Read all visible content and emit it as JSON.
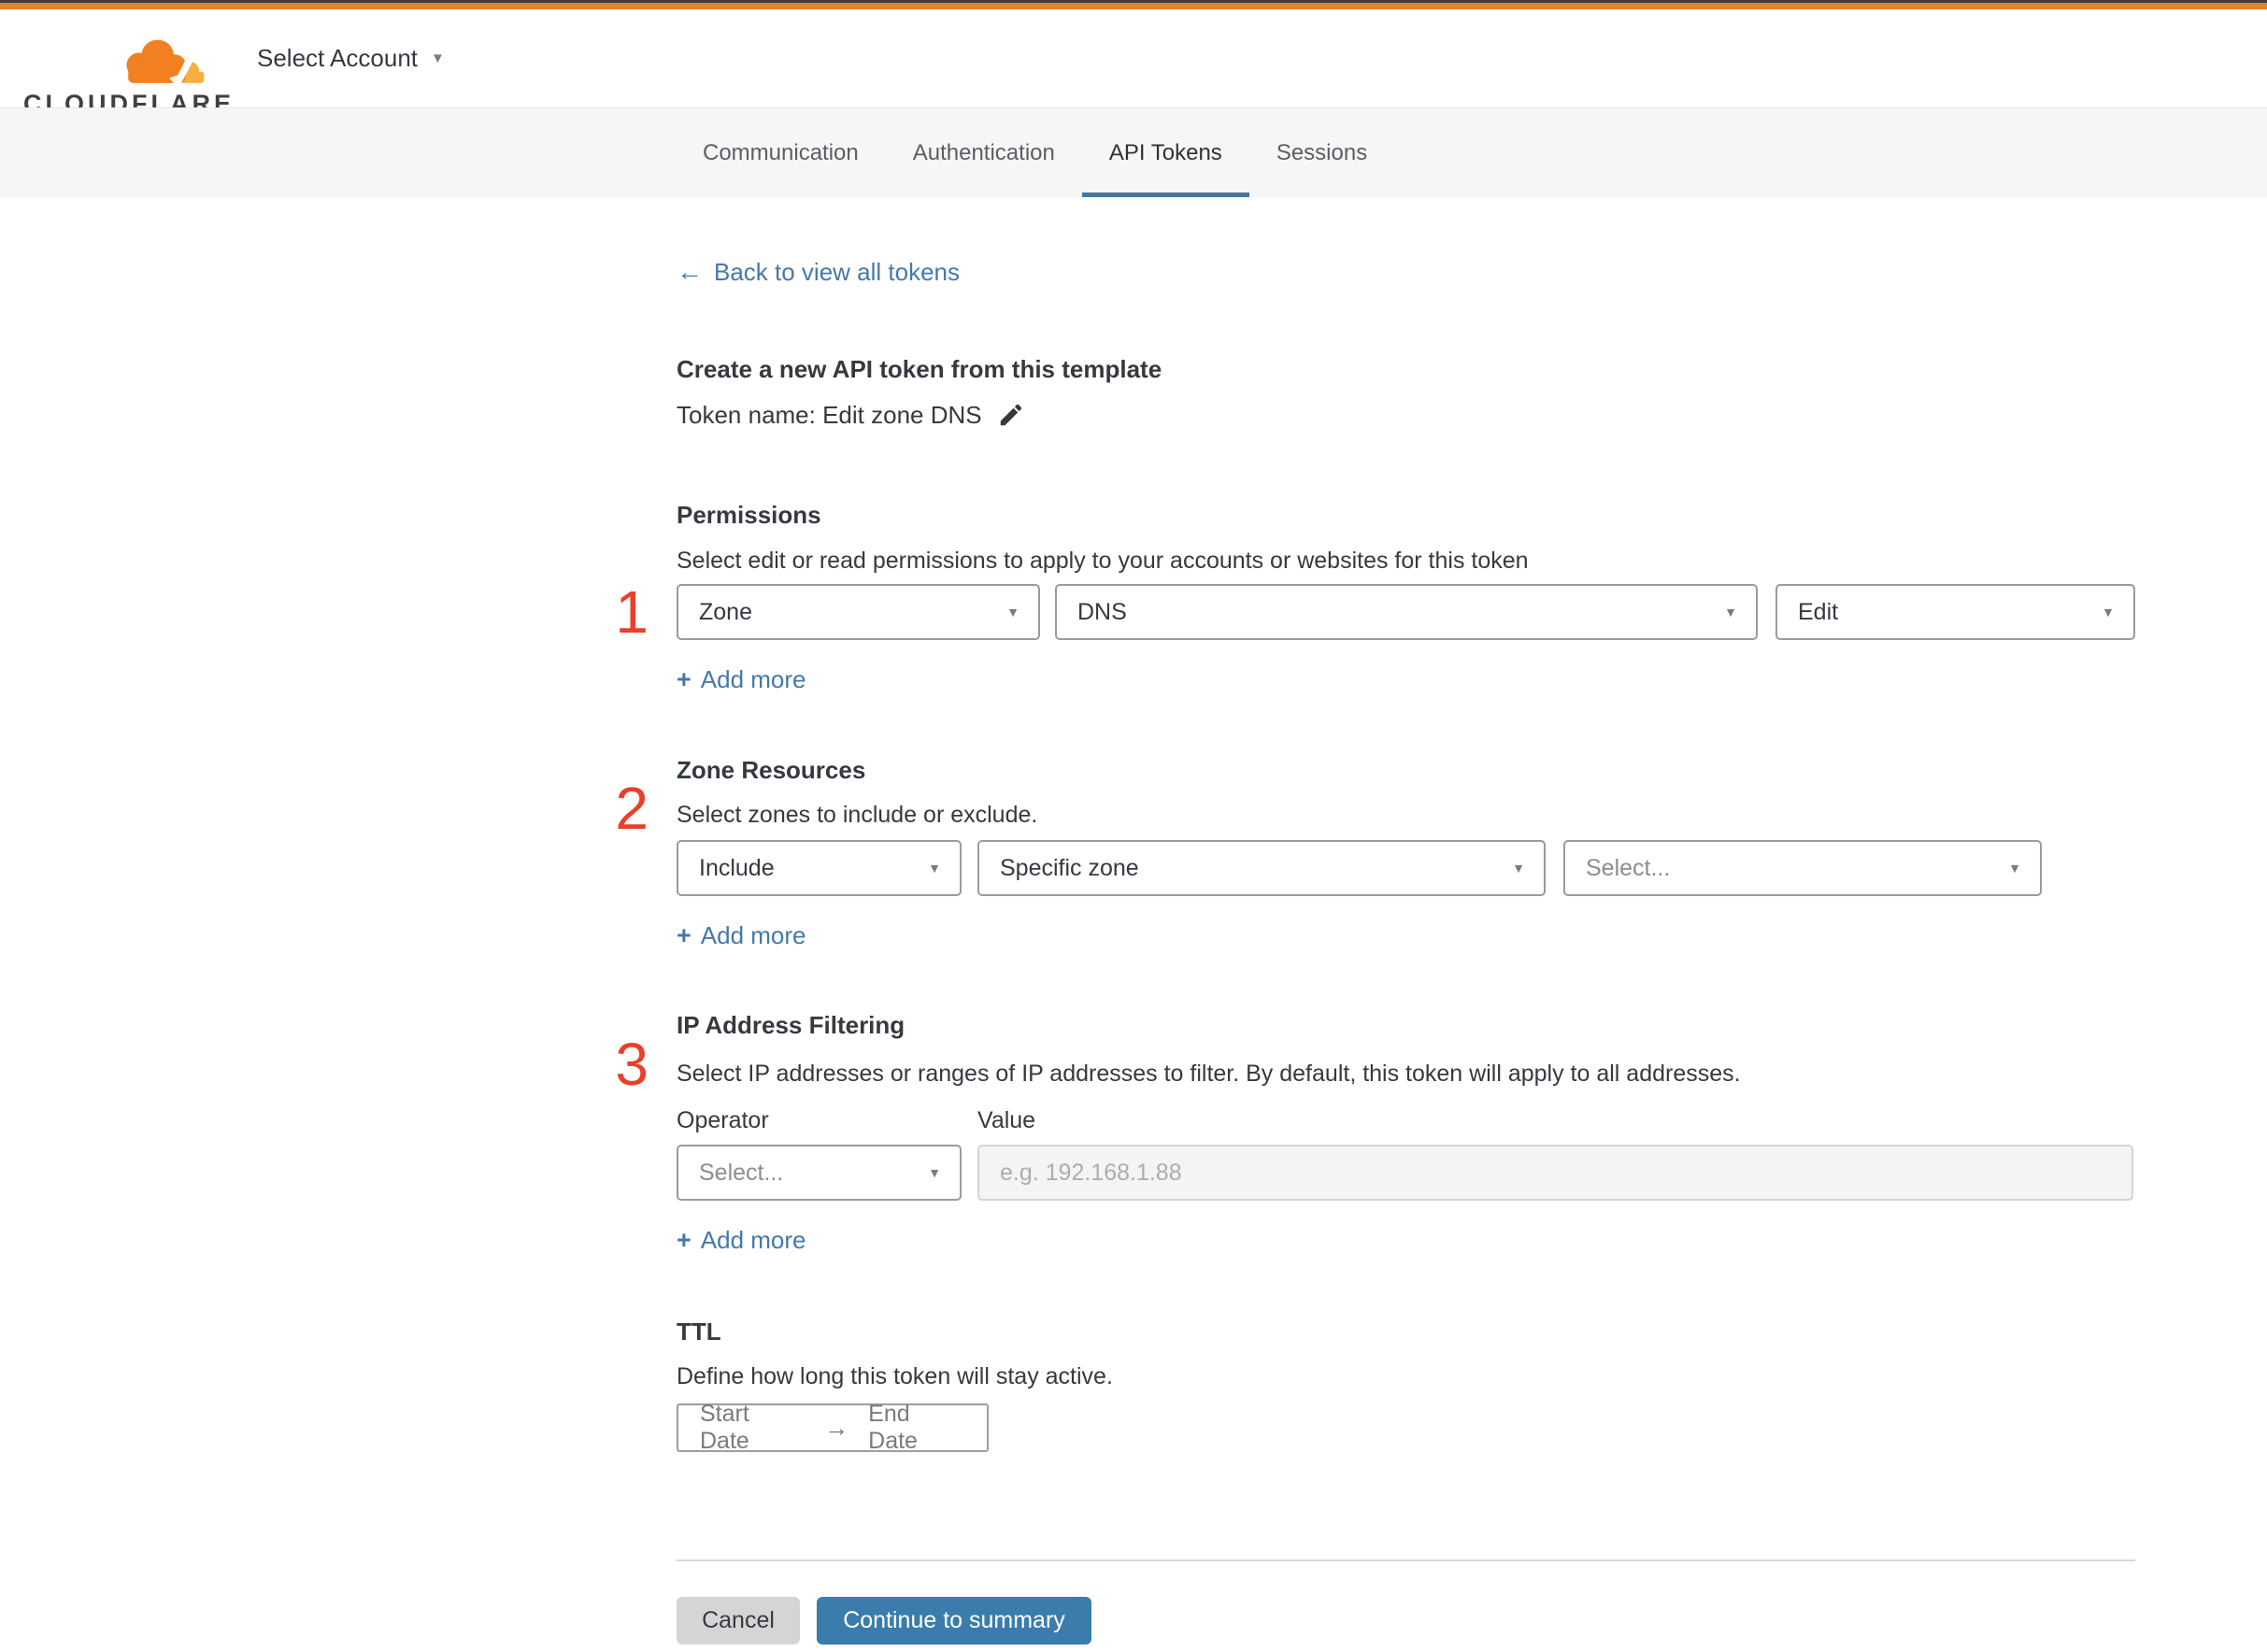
{
  "header": {
    "logo_text": "CLOUDFLARE",
    "account_selector_label": "Select Account"
  },
  "tabs": [
    {
      "label": "Communication"
    },
    {
      "label": "Authentication"
    },
    {
      "label": "API Tokens"
    },
    {
      "label": "Sessions"
    }
  ],
  "active_tab": "API Tokens",
  "icons": {
    "back_arrow": "←",
    "caret_down": "▼",
    "plus": "+",
    "arrow_right": "→"
  },
  "page": {
    "back_link_label": "Back to view all tokens",
    "title": "Create a new API token from this template",
    "token_name_line": "Token name: Edit zone DNS",
    "steps": {
      "one": "1",
      "two": "2",
      "three": "3"
    }
  },
  "permissions": {
    "heading": "Permissions",
    "description": "Select edit or read permissions to apply to your accounts or websites for this token",
    "scope_value": "Zone",
    "permission_value": "DNS",
    "access_value": "Edit",
    "add_more_label": "Add more"
  },
  "zone_resources": {
    "heading": "Zone Resources",
    "description": "Select zones to include or exclude.",
    "mode_value": "Include",
    "type_value": "Specific zone",
    "zone_placeholder": "Select...",
    "add_more_label": "Add more"
  },
  "ip_filtering": {
    "heading": "IP Address Filtering",
    "description": "Select IP addresses or ranges of IP addresses to filter. By default, this token will apply to all addresses.",
    "operator_label": "Operator",
    "value_label": "Value",
    "operator_placeholder": "Select...",
    "value_placeholder": "e.g. 192.168.1.88",
    "add_more_label": "Add more"
  },
  "ttl": {
    "heading": "TTL",
    "description": "Define how long this token will stay active.",
    "start_label": "Start Date",
    "end_label": "End Date"
  },
  "footer": {
    "cancel_label": "Cancel",
    "continue_label": "Continue to summary"
  },
  "colors": {
    "brand_orange": "#e0832f",
    "logo_orange": "#f38020",
    "logo_light_orange": "#faae40",
    "accent_blue": "#3b7cac",
    "link_blue": "#4678a9",
    "step_red": "#e8402a"
  }
}
